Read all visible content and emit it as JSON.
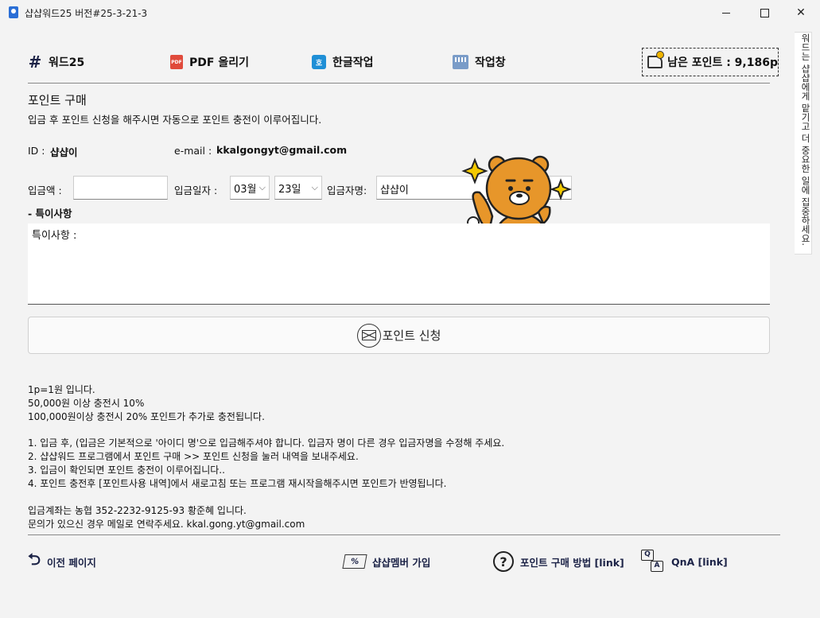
{
  "window": {
    "title": "샵샵워드25  버전#25-3-21-3"
  },
  "nav": {
    "word": "워드25",
    "pdf": "PDF 올리기",
    "hangul": "한글작업",
    "work": "작업창",
    "pdf_icon_text": "PDF",
    "hangul_icon_text": "호"
  },
  "points": {
    "label": "남은 포인트 : 9,186p"
  },
  "purchase": {
    "title": "포인트 구매",
    "desc": "입금 후 포인트 신청을 해주시면 자동으로 포인트 충전이 이루어집니다.",
    "id_label": "ID :",
    "id_value": "샵샵이",
    "email_label": "e-mail :",
    "email_value": "kkalgongyt@gmail.com",
    "amount_label": "입금액 :",
    "amount_value": "",
    "date_label": "입금일자 :",
    "month": "03월",
    "day": "23일",
    "depositor_label": "입금자명:",
    "depositor_value": "샵샵이",
    "note_title": "- 특이사항",
    "note_value": "특이사항 :",
    "submit": "포인트 신청"
  },
  "info": {
    "lines": [
      "1p=1원 입니다.",
      "50,000원 이상 충전시 10%",
      "100,000원이상 충전시 20% 포인트가 추가로 충전됩니다.",
      "1. 입금 후, (입금은 기본적으로 '아이디 명'으로 입금해주셔야 합니다. 입금자 명이 다른 경우 입금자명을 수정해 주세요.",
      "2. 샵샵워드 프로그램에서 포인트 구매 >> 포인트 신청을 눌러 내역을 보내주세요.",
      "3. 입금이 확인되면 포인트 충전이 이루어집니다..",
      "4. 포인트 충전후 [포인트사용 내역]에서 새로고침 또는 프로그램 재시작을해주시면 포인트가 반영됩니다.",
      "입금계좌는 농협 352-2232-9125-93 황준혜 입니다.",
      "문의가 있으신 경우 메일로 연락주세요. kkal.gong.yt@gmail.com"
    ]
  },
  "footer": {
    "back": "이전 페이지",
    "member": "샵샵멤버 가입",
    "howto": "포인트 구매 방법 [link]",
    "qna": "QnA [link]",
    "coupon_icon_text": "%",
    "question_icon_text": "?",
    "qna_q": "Q",
    "qna_a": "A"
  },
  "side": {
    "text": "워드는 샵샵에게 맡기고 더 중요한 일에 집중하세요."
  },
  "icons": {
    "back": "back-arrow-icon",
    "coupon": "coupon-icon",
    "question": "question-icon",
    "qna": "qna-icon",
    "mail": "mail-icon",
    "hand_coin": "hand-coin-icon"
  }
}
